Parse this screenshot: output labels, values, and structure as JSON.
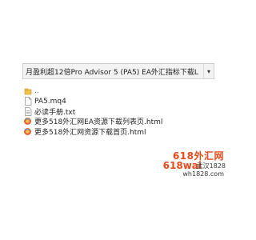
{
  "address_bar": {
    "path": "月盈利超12倍Pro Advisor 5 (PA5) EA外汇指标下载L",
    "dropdown_icon": "chevron-down-icon"
  },
  "files": [
    {
      "label": "..",
      "icon": "folder-up-icon"
    },
    {
      "label": "PA5.mq4",
      "icon": "file-icon"
    },
    {
      "label": "必读手册.txt",
      "icon": "text-file-icon"
    },
    {
      "label": "更多518外汇网EA资源下载列表页.html",
      "icon": "html-file-icon"
    },
    {
      "label": "更多518外汇网资源下载首页.html",
      "icon": "html-file-icon"
    }
  ],
  "watermark": {
    "line1": "618外汇网",
    "line2": "618wai",
    "line2_suffix": "武汉1828",
    "line3": "wh1828.com"
  },
  "colors": {
    "watermark_accent": "#e64a1b"
  }
}
